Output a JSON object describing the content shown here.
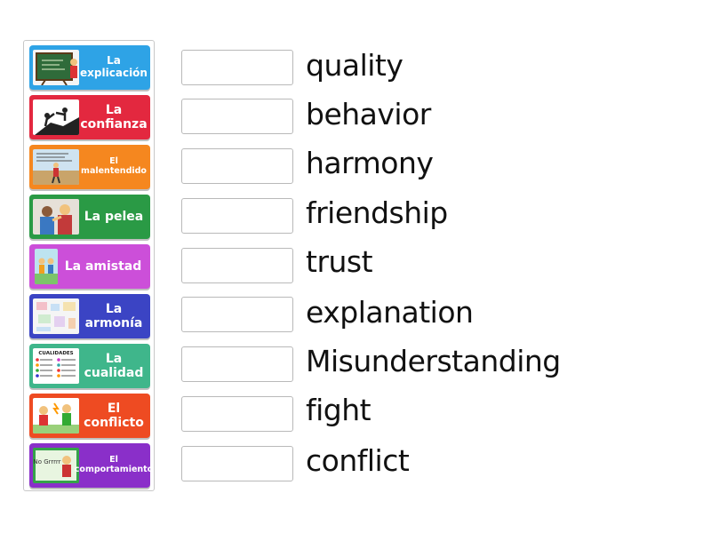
{
  "colors": {
    "tile_blue": "#2ea3e6",
    "tile_red": "#e3283f",
    "tile_orange": "#f5871f",
    "tile_green": "#2a9a45",
    "tile_magenta": "#cc4fd9",
    "tile_indigo": "#3b44c4",
    "tile_teal": "#3fb68b",
    "tile_redorange": "#ee4b22",
    "tile_purple": "#8a2fc9"
  },
  "tiles": [
    {
      "label": "La explicación",
      "color": "#2ea3e6",
      "icon": "teacher-blackboard-icon"
    },
    {
      "label": "La confianza",
      "color": "#e3283f",
      "icon": "helping-hand-icon"
    },
    {
      "label": "El malentendido",
      "color": "#f5871f",
      "icon": "confused-person-icon"
    },
    {
      "label": "La pelea",
      "color": "#2a9a45",
      "icon": "fighting-kids-icon"
    },
    {
      "label": "La amistad",
      "color": "#cc4fd9",
      "icon": "friends-icon"
    },
    {
      "label": "La armonía",
      "color": "#3b44c4",
      "icon": "harmony-collage-icon"
    },
    {
      "label": "La cualidad",
      "color": "#3fb68b",
      "icon": "qualities-chart-icon"
    },
    {
      "label": "El conflicto",
      "color": "#ee4b22",
      "icon": "conflict-kids-icon"
    },
    {
      "label": "El comportamiento",
      "color": "#8a2fc9",
      "icon": "behavior-sign-icon"
    }
  ],
  "qualities_image_text": "CUALIDADES",
  "behavior_image_text": "No Grrrrr",
  "words": [
    "quality",
    "behavior",
    "harmony",
    "friendship",
    "trust",
    "explanation",
    "Misunderstanding",
    "fight",
    "conflict"
  ]
}
